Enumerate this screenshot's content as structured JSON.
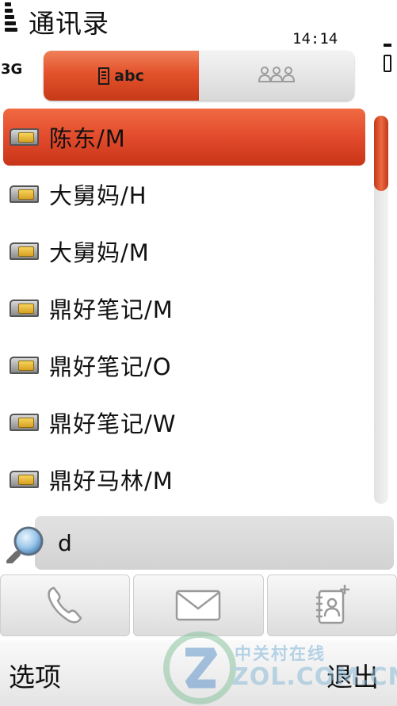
{
  "status": {
    "title": "通讯录",
    "time": "14:14",
    "network": "3G"
  },
  "tabs": [
    {
      "label": "abc",
      "icon": "list-icon",
      "active": true
    },
    {
      "label": "",
      "icon": "group-icon",
      "active": false
    }
  ],
  "contacts": [
    {
      "name": "陈东/M",
      "icon": "sim-card-icon",
      "selected": true
    },
    {
      "name": "大舅妈/H",
      "icon": "sim-card-icon",
      "selected": false
    },
    {
      "name": "大舅妈/M",
      "icon": "sim-card-icon",
      "selected": false
    },
    {
      "name": "鼎好笔记/M",
      "icon": "sim-card-icon",
      "selected": false
    },
    {
      "name": "鼎好笔记/O",
      "icon": "sim-card-icon",
      "selected": false
    },
    {
      "name": "鼎好笔记/W",
      "icon": "sim-card-icon",
      "selected": false
    },
    {
      "name": "鼎好马林/M",
      "icon": "sim-card-icon",
      "selected": false
    }
  ],
  "search": {
    "value": "d",
    "icon": "magnifier-icon"
  },
  "actions": [
    {
      "icon": "phone-icon"
    },
    {
      "icon": "envelope-icon"
    },
    {
      "icon": "add-contact-icon"
    }
  ],
  "softkeys": {
    "left": "选项",
    "right": "退出"
  },
  "watermark": {
    "cn": "中关村在线",
    "en": "ZOL.COM.CN"
  },
  "colors": {
    "accent": "#e24d2c",
    "accent_dark": "#c63a18",
    "field_bg": "#d8d8d8"
  }
}
